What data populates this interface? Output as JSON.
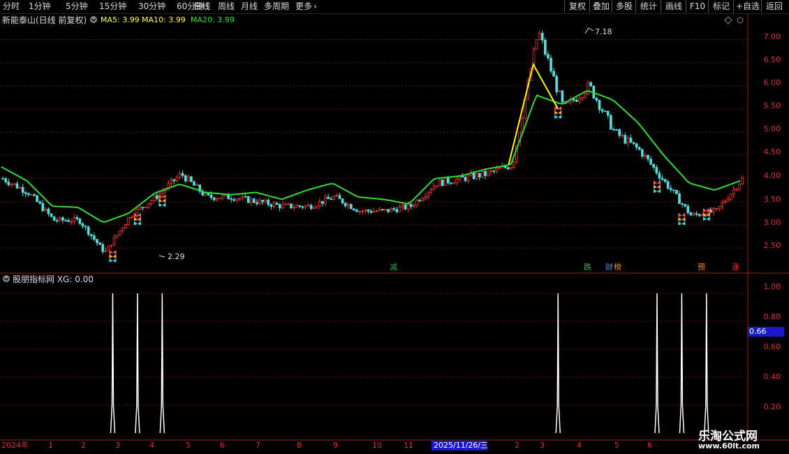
{
  "toolbar": {
    "periods": [
      "分时",
      "1分钟",
      "5分钟",
      "15分钟",
      "30分钟",
      "60分钟",
      "日线",
      "周线",
      "月线",
      "多周期",
      "更多"
    ],
    "active_period": "日线",
    "more_chevron": "›",
    "buttons": [
      "复权",
      "叠加",
      "多股",
      "统计",
      "画线",
      "F10",
      "标记",
      "+自选",
      "返回"
    ]
  },
  "main_chart": {
    "stock_name": "新能泰山(日线 前复权)",
    "ma5_label": "MA5: 3.99",
    "ma10_label": "MA10: 3.99",
    "ma20_label": "MA20: 3.99",
    "high_label": "7.18",
    "low_label": "2.29",
    "price_scale": [
      "7.00",
      "6.50",
      "6.00",
      "5.50",
      "5.00",
      "4.50",
      "4.00",
      "3.50",
      "3.00",
      "2.50"
    ],
    "markers": [
      {
        "text": "减",
        "color": "#2db84d"
      },
      {
        "text": "跌",
        "color": "#2db84d"
      },
      {
        "text": "财",
        "color": "#4d8cff"
      },
      {
        "text": "榜",
        "color": "#ff8c00"
      },
      {
        "text": "预",
        "color": "#ff8c00"
      },
      {
        "text": "涨",
        "color": "#ff3333"
      }
    ],
    "colors": {
      "ma20": "#33dd33",
      "ma5": "#ffff00",
      "up": "#ff3333",
      "down": "#55dddd"
    }
  },
  "indicator": {
    "title": "股朋指标网 XG: 0.00",
    "scale": [
      "1.00",
      "0.80",
      "0.60",
      "0.40",
      "0.20"
    ],
    "cursor_value": "0.66"
  },
  "time_axis": {
    "year_label": "2024年",
    "months": [
      "1",
      "2",
      "3",
      "4",
      "5",
      "6",
      "7",
      "8",
      "9",
      "10",
      "11",
      "2",
      "3",
      "4",
      "5",
      "6"
    ],
    "cursor_date": "2025/11/26/三"
  },
  "watermark": {
    "title": "乐淘公式网",
    "url": "www.60lt.com"
  },
  "chart_data": {
    "type": "line",
    "title": "新能泰山(日线 前复权)",
    "xlabel": "",
    "ylabel": "",
    "ylim": [
      2.2,
      7.4
    ],
    "x": [
      "2024-01",
      "2024-02",
      "2024-03",
      "2024-04",
      "2024-05",
      "2024-06",
      "2024-07",
      "2024-08",
      "2024-09",
      "2024-10",
      "2024-11",
      "2024-12",
      "2025-01",
      "2025-02",
      "2025-03",
      "2025-04",
      "2025-05",
      "2025-06",
      "2025-07",
      "2025-08",
      "2025-09",
      "2025-10",
      "2025-11",
      "2025-12",
      "2026-01",
      "2026-02",
      "2026-03",
      "2026-04",
      "2026-05",
      "2026-06"
    ],
    "series": [
      {
        "name": "MA20",
        "values": [
          4.25,
          3.95,
          3.4,
          3.38,
          3.05,
          3.25,
          3.68,
          3.88,
          3.7,
          3.65,
          3.7,
          3.55,
          3.75,
          3.9,
          3.6,
          3.55,
          3.45,
          4.0,
          4.05,
          4.2,
          4.3,
          5.8,
          5.6,
          5.9,
          5.7,
          5.2,
          4.5,
          3.9,
          3.75,
          3.95
        ]
      },
      {
        "name": "close",
        "values": [
          4.0,
          3.7,
          3.1,
          3.1,
          2.4,
          3.2,
          3.6,
          4.1,
          3.6,
          3.6,
          3.5,
          3.4,
          3.4,
          3.6,
          3.3,
          3.3,
          3.4,
          3.9,
          4.0,
          4.1,
          4.3,
          7.18,
          5.5,
          6.0,
          5.0,
          4.6,
          3.9,
          3.2,
          3.3,
          4.0
        ]
      }
    ],
    "signals_xg": [
      {
        "x": "2024-05",
        "value": 1
      },
      {
        "x": "2024-06",
        "value": 1
      },
      {
        "x": "2024-07",
        "value": 1
      },
      {
        "x": "2025-11",
        "value": 1
      },
      {
        "x": "2026-03",
        "value": 1
      },
      {
        "x": "2026-04",
        "value": 1
      },
      {
        "x": "2026-05",
        "value": 1
      }
    ],
    "indicator_ylim": [
      0,
      1.05
    ]
  }
}
